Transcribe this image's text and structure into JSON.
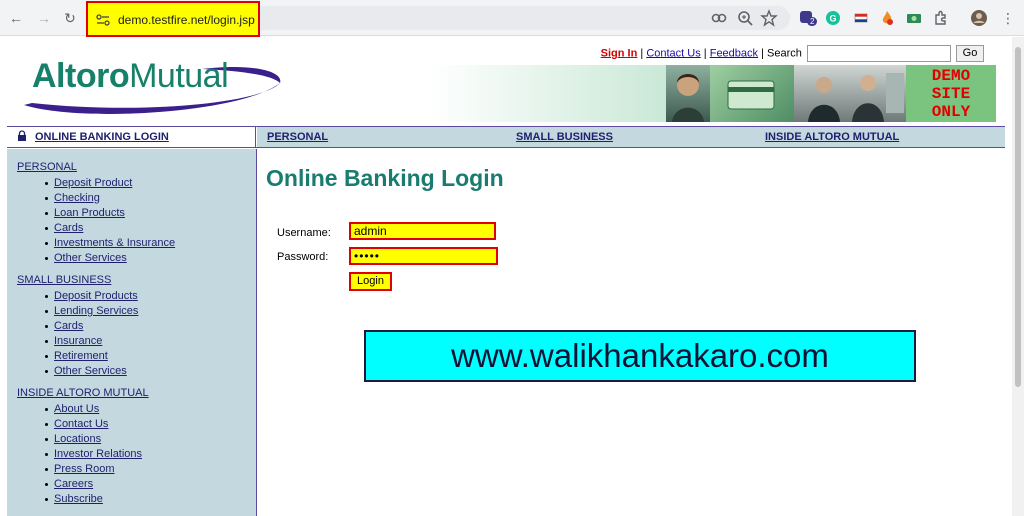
{
  "browser": {
    "url": "demo.testfire.net/login.jsp",
    "back_icon": "arrow-left-icon",
    "forward_icon": "arrow-right-icon",
    "reload_icon": "reload-icon",
    "extension_badge": "2"
  },
  "header": {
    "sign_in": "Sign In",
    "sep1": "|",
    "contact": "Contact Us",
    "sep2": "|",
    "feedback": "Feedback",
    "sep3": "|",
    "search_label": "Search",
    "search_value": "",
    "go": "Go",
    "logo_brand1": "Altoro",
    "logo_brand2": "Mutual",
    "demo_line1": "DEMO",
    "demo_line2": "SITE",
    "demo_line3": "ONLY"
  },
  "navbar": {
    "login": "ONLINE BANKING LOGIN",
    "personal": "PERSONAL",
    "small_business": "SMALL BUSINESS",
    "inside": "INSIDE ALTORO MUTUAL"
  },
  "sidebar": {
    "sections": [
      {
        "title": "PERSONAL",
        "items": [
          "Deposit Product",
          "Checking",
          "Loan Products",
          "Cards",
          "Investments & Insurance",
          "Other Services"
        ]
      },
      {
        "title": "SMALL BUSINESS",
        "items": [
          "Deposit Products",
          "Lending Services",
          "Cards",
          "Insurance",
          "Retirement",
          "Other Services"
        ]
      },
      {
        "title": "INSIDE ALTORO MUTUAL",
        "items": [
          "About Us",
          "Contact Us",
          "Locations",
          "Investor Relations",
          "Press Room",
          "Careers",
          "Subscribe"
        ]
      }
    ]
  },
  "main": {
    "title": "Online Banking Login",
    "username_label": "Username:",
    "username_value": "admin",
    "password_label": "Password:",
    "password_value": "•••••",
    "login_button": "Login",
    "watermark": "www.walikhankakaro.com"
  },
  "colors": {
    "highlight": "#ffff00",
    "highlight_border": "#e00000",
    "brand_green": "#17806a",
    "nav_blue": "#c4d8e0",
    "watermark_bg": "#00ffff"
  }
}
